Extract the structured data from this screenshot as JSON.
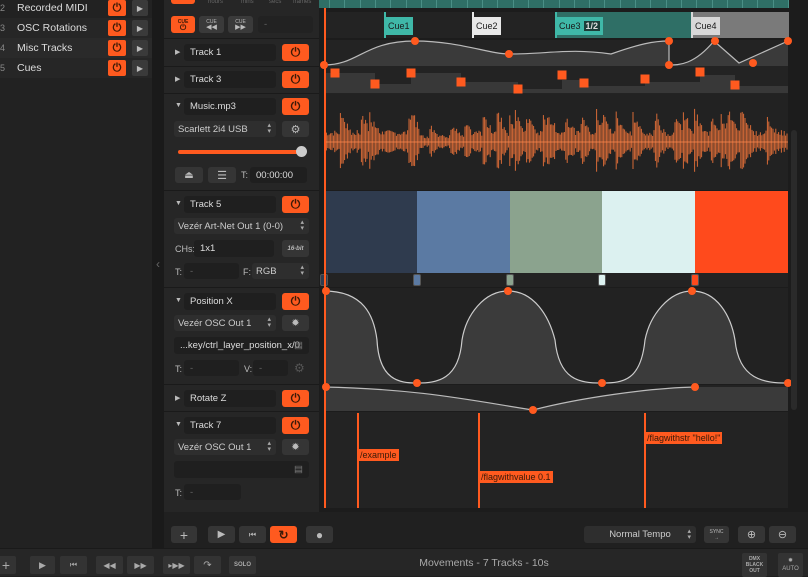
{
  "compositions": [
    {
      "num": "2",
      "name": "Recorded MIDI"
    },
    {
      "num": "3",
      "name": "OSC Rotations"
    },
    {
      "num": "4",
      "name": "Misc Tracks"
    },
    {
      "num": "5",
      "name": "Cues"
    }
  ],
  "time_units": [
    "hours",
    "mins",
    "secs",
    "frames"
  ],
  "cue_buttons": {
    "cue_toggle": "CUE",
    "cue_prev": "CUE",
    "cue_next": "CUE",
    "cue_display": "-"
  },
  "tracks": {
    "track1": {
      "name": "Track 1"
    },
    "track3": {
      "name": "Track 3"
    },
    "music": {
      "name": "Music.mp3",
      "device": "Scarlett 2i4 USB",
      "volume": 1.0,
      "time_label": "T:",
      "time_value": "00:00:00"
    },
    "track5": {
      "name": "Track 5",
      "device": "Vezér Art-Net Out 1 (0-0)",
      "chs_label": "CHs:",
      "chs_value": "1x1",
      "bit_label": "16-bit",
      "t_label": "T:",
      "t_value": "-",
      "f_label": "F:",
      "f_value": "RGB"
    },
    "posx": {
      "name": "Position X",
      "device": "Vezér OSC Out 1",
      "address": "...key/ctrl_layer_position_x/0",
      "t_label": "T:",
      "t_value": "-",
      "v_label": "V:",
      "v_value": "-"
    },
    "rotz": {
      "name": "Rotate Z"
    },
    "track7": {
      "name": "Track 7",
      "device": "Vezér OSC Out 1",
      "address": "",
      "t_label": "T:",
      "t_value": "-"
    }
  },
  "cues": [
    {
      "label": "Cue1",
      "color": "#3fb8a8"
    },
    {
      "label": "Cue2",
      "color": "#e8e8e8"
    },
    {
      "label": "Cue3",
      "badge": "1/2",
      "color": "#3fb8a8"
    },
    {
      "label": "Cue4",
      "color": "#d8d8d8"
    }
  ],
  "color_track": [
    "#2f3b4e",
    "#5b7aa3",
    "#8ba38e",
    "#dcf1f0",
    "#ff4a1c"
  ],
  "osc_flags": [
    "/example",
    "/flagwithvalue 0.1",
    "/flagwithstr \"hello!\""
  ],
  "transport": {
    "tempo": "Normal Tempo",
    "sync": "SYNC"
  },
  "statusbar": {
    "solo": "SOLO",
    "title": "Movements - 7 Tracks - 10s",
    "blackout": "DMX BLACK OUT",
    "auto": "AUTO"
  },
  "colors": {
    "accent": "#ff5a1f",
    "teal": "#3fb8a8",
    "bg": "#1e1e1e"
  }
}
